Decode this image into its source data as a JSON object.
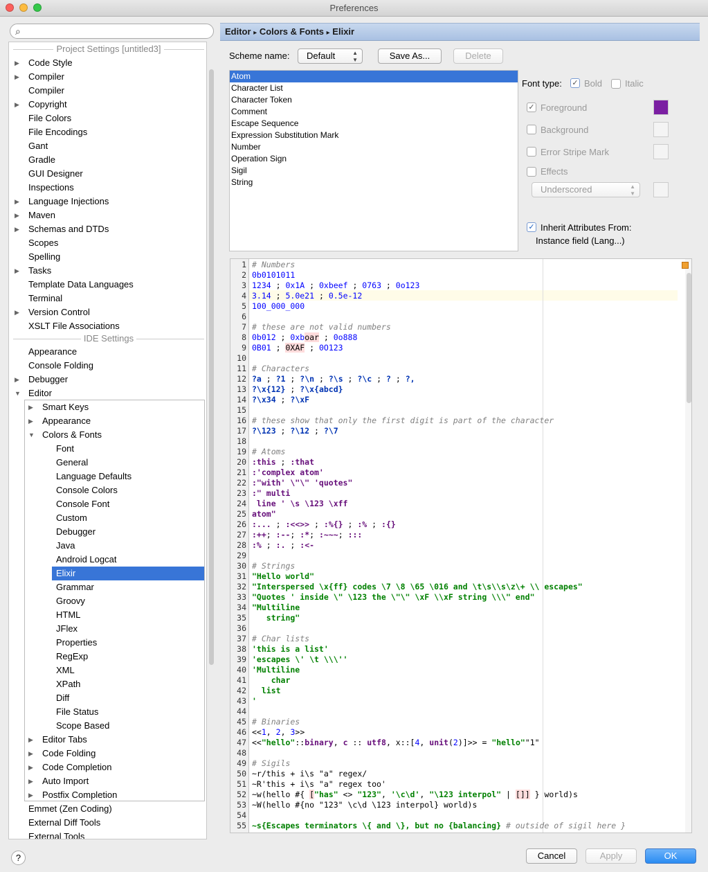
{
  "window": {
    "title": "Preferences"
  },
  "search": {
    "placeholder": ""
  },
  "sidebar": {
    "section_project": "Project Settings [untitled3]",
    "project_items": [
      {
        "label": "Code Style",
        "arrow": "▶"
      },
      {
        "label": "Compiler",
        "arrow": "▶"
      },
      {
        "label": "Compiler",
        "arrow": ""
      },
      {
        "label": "Copyright",
        "arrow": "▶"
      },
      {
        "label": "File Colors",
        "arrow": ""
      },
      {
        "label": "File Encodings",
        "arrow": ""
      },
      {
        "label": "Gant",
        "arrow": ""
      },
      {
        "label": "Gradle",
        "arrow": ""
      },
      {
        "label": "GUI Designer",
        "arrow": ""
      },
      {
        "label": "Inspections",
        "arrow": ""
      },
      {
        "label": "Language Injections",
        "arrow": "▶"
      },
      {
        "label": "Maven",
        "arrow": "▶"
      },
      {
        "label": "Schemas and DTDs",
        "arrow": "▶"
      },
      {
        "label": "Scopes",
        "arrow": ""
      },
      {
        "label": "Spelling",
        "arrow": ""
      },
      {
        "label": "Tasks",
        "arrow": "▶"
      },
      {
        "label": "Template Data Languages",
        "arrow": ""
      },
      {
        "label": "Terminal",
        "arrow": ""
      },
      {
        "label": "Version Control",
        "arrow": "▶"
      },
      {
        "label": "XSLT File Associations",
        "arrow": ""
      }
    ],
    "section_ide": "IDE Settings",
    "ide_items": [
      {
        "label": "Appearance",
        "arrow": ""
      },
      {
        "label": "Console Folding",
        "arrow": ""
      },
      {
        "label": "Debugger",
        "arrow": "▶"
      },
      {
        "label": "Editor",
        "arrow": "▼"
      }
    ],
    "editor_items": [
      {
        "label": "Smart Keys",
        "arrow": "▶"
      },
      {
        "label": "Appearance",
        "arrow": "▶"
      },
      {
        "label": "Colors & Fonts",
        "arrow": "▼"
      }
    ],
    "colors_fonts_items": [
      "Font",
      "General",
      "Language Defaults",
      "Console Colors",
      "Console Font",
      "Custom",
      "Debugger",
      "Java",
      "Android Logcat",
      "Elixir",
      "Grammar",
      "Groovy",
      "HTML",
      "JFlex",
      "Properties",
      "RegExp",
      "XML",
      "XPath",
      "Diff",
      "File Status",
      "Scope Based"
    ],
    "selected": "Elixir",
    "editor_items_after": [
      {
        "label": "Editor Tabs",
        "arrow": "▶"
      },
      {
        "label": "Code Folding",
        "arrow": "▶"
      },
      {
        "label": "Code Completion",
        "arrow": "▶"
      },
      {
        "label": "Auto Import",
        "arrow": "▶"
      },
      {
        "label": "Postfix Completion",
        "arrow": "▶"
      }
    ],
    "ide_items_after": [
      {
        "label": "Emmet (Zen Coding)",
        "arrow": ""
      },
      {
        "label": "External Diff Tools",
        "arrow": ""
      },
      {
        "label": "External Tools",
        "arrow": ""
      }
    ]
  },
  "breadcrumb": {
    "parts": [
      "Editor",
      "Colors & Fonts",
      "Elixir"
    ],
    "separator": "▸"
  },
  "scheme": {
    "label": "Scheme name:",
    "value": "Default",
    "save_as": "Save As...",
    "delete": "Delete"
  },
  "attributes": {
    "items": [
      "Atom",
      "Character List",
      "Character Token",
      "Comment",
      "Escape Sequence",
      "Expression Substitution Mark",
      "Number",
      "Operation Sign",
      "Sigil",
      "String"
    ],
    "selected": "Atom"
  },
  "options": {
    "font_type_label": "Font type:",
    "bold_label": "Bold",
    "bold_checked": true,
    "italic_label": "Italic",
    "italic_checked": false,
    "foreground_label": "Foreground",
    "foreground_checked": true,
    "foreground_color": "#7b1fa2",
    "background_label": "Background",
    "error_stripe_label": "Error Stripe Mark",
    "effects_label": "Effects",
    "effects_value": "Underscored",
    "inherit_label": "Inherit Attributes From:",
    "inherit_checked": true,
    "inherit_source": "Instance field (Lang...)"
  },
  "preview": {
    "lines": [
      [
        [
          "c",
          "# Numbers"
        ]
      ],
      [
        [
          "n",
          "0b0101011"
        ]
      ],
      [
        [
          "n",
          "1234"
        ],
        [
          "p",
          " ; "
        ],
        [
          "n",
          "0x1A"
        ],
        [
          "p",
          " ; "
        ],
        [
          "n",
          "0xbeef"
        ],
        [
          "p",
          " ; "
        ],
        [
          "n",
          "0763"
        ],
        [
          "p",
          " ; "
        ],
        [
          "n",
          "0o123"
        ]
      ],
      [
        [
          "n",
          "3.14"
        ],
        [
          "p",
          " ; "
        ],
        [
          "n",
          "5.0e21"
        ],
        [
          "p",
          " ; "
        ],
        [
          "n",
          "0.5e-12"
        ]
      ],
      [
        [
          "n",
          "100_000_000"
        ]
      ],
      [],
      [
        [
          "c",
          "# these are not valid numbers"
        ]
      ],
      [
        [
          "n",
          "0b012"
        ],
        [
          "p",
          " ; "
        ],
        [
          "n",
          "0xb"
        ],
        [
          "x",
          "oar"
        ],
        [
          "p",
          " ; "
        ],
        [
          "n",
          "0o888"
        ]
      ],
      [
        [
          "n",
          "0B01"
        ],
        [
          "p",
          " ; "
        ],
        [
          "x",
          "0XAF"
        ],
        [
          "p",
          " ; "
        ],
        [
          "n",
          "0O123"
        ]
      ],
      [],
      [
        [
          "c",
          "# Characters"
        ]
      ],
      [
        [
          "t",
          "?a"
        ],
        [
          "p",
          " ; "
        ],
        [
          "t",
          "?1"
        ],
        [
          "p",
          " ; "
        ],
        [
          "t",
          "?\\n"
        ],
        [
          "p",
          " ; "
        ],
        [
          "t",
          "?\\s"
        ],
        [
          "p",
          " ; "
        ],
        [
          "t",
          "?\\c"
        ],
        [
          "p",
          " ; "
        ],
        [
          "t",
          "? "
        ],
        [
          "p",
          "; "
        ],
        [
          "t",
          "?,"
        ]
      ],
      [
        [
          "t",
          "?\\x{12}"
        ],
        [
          "p",
          " ; "
        ],
        [
          "t",
          "?\\x{abcd}"
        ]
      ],
      [
        [
          "t",
          "?\\x34"
        ],
        [
          "p",
          " ; "
        ],
        [
          "t",
          "?\\xF"
        ]
      ],
      [],
      [
        [
          "c",
          "# these show that only the first digit is part of the character"
        ]
      ],
      [
        [
          "t",
          "?\\123"
        ],
        [
          "p",
          " ; "
        ],
        [
          "t",
          "?\\12"
        ],
        [
          "p",
          " ; "
        ],
        [
          "t",
          "?\\7"
        ]
      ],
      [],
      [
        [
          "c",
          "# Atoms"
        ]
      ],
      [
        [
          "a",
          ":this"
        ],
        [
          "p",
          " ; "
        ],
        [
          "a",
          ":that"
        ]
      ],
      [
        [
          "a",
          ":'complex atom'"
        ]
      ],
      [
        [
          "a",
          ":\"with' \\\"\\\" 'quotes\""
        ]
      ],
      [
        [
          "a",
          ":\" multi"
        ]
      ],
      [
        [
          "a",
          " line ' \\s \\123 \\xff"
        ]
      ],
      [
        [
          "a",
          "atom\""
        ]
      ],
      [
        [
          "a",
          ":..."
        ],
        [
          "p",
          " ; "
        ],
        [
          "a",
          ":<<>>"
        ],
        [
          "p",
          " ; "
        ],
        [
          "a",
          ":%{}"
        ],
        [
          "p",
          " ; "
        ],
        [
          "a",
          ":%"
        ],
        [
          "p",
          " ; "
        ],
        [
          "a",
          ":{}"
        ]
      ],
      [
        [
          "a",
          ":++"
        ],
        [
          "p",
          "; "
        ],
        [
          "a",
          ":--"
        ],
        [
          "p",
          "; "
        ],
        [
          "a",
          ":*"
        ],
        [
          "p",
          "; "
        ],
        [
          "a",
          ":~~~"
        ],
        [
          "p",
          "; "
        ],
        [
          "a",
          ":::"
        ]
      ],
      [
        [
          "a",
          ":%"
        ],
        [
          "p",
          " ; "
        ],
        [
          "a",
          ":."
        ],
        [
          "p",
          " ; "
        ],
        [
          "a",
          ":<-"
        ]
      ],
      [],
      [
        [
          "c",
          "# Strings"
        ]
      ],
      [
        [
          "s",
          "\"Hello world\""
        ]
      ],
      [
        [
          "s",
          "\"Interspersed \\x{ff} codes \\7 \\8 \\65 \\016 and \\t\\s\\\\s\\z\\+ \\\\ escapes\""
        ]
      ],
      [
        [
          "s",
          "\"Quotes ' inside \\\" \\123 the \\\"\\\" \\xF \\\\xF string \\\\\\\" end\""
        ]
      ],
      [
        [
          "s",
          "\"Multiline"
        ]
      ],
      [
        [
          "s",
          "   string\""
        ]
      ],
      [],
      [
        [
          "c",
          "# Char lists"
        ]
      ],
      [
        [
          "s",
          "'this is a list'"
        ]
      ],
      [
        [
          "s",
          "'escapes \\' \\t \\\\\\''"
        ]
      ],
      [
        [
          "s",
          "'Multiline"
        ]
      ],
      [
        [
          "s",
          "    char"
        ]
      ],
      [
        [
          "s",
          "  list"
        ]
      ],
      [
        [
          "s",
          "'"
        ]
      ],
      [],
      [
        [
          "c",
          "# Binaries"
        ]
      ],
      [
        [
          "p",
          "<<"
        ],
        [
          "n",
          "1"
        ],
        [
          "p",
          ", "
        ],
        [
          "n",
          "2"
        ],
        [
          "p",
          ", "
        ],
        [
          "n",
          "3"
        ],
        [
          "p",
          ">>"
        ]
      ],
      [
        [
          "p",
          "<<"
        ],
        [
          "s",
          "\"hello\""
        ],
        [
          "p",
          "::"
        ],
        [
          "a",
          "binary"
        ],
        [
          "p",
          ", "
        ],
        [
          "a",
          "c"
        ],
        [
          "p",
          " :: "
        ],
        [
          "a",
          "utf8"
        ],
        [
          "p",
          ", x::["
        ],
        [
          "n",
          "4"
        ],
        [
          "p",
          ", "
        ],
        [
          "a",
          "unit"
        ],
        [
          "p",
          "("
        ],
        [
          "n",
          "2"
        ],
        [
          "p",
          ")]>> = "
        ],
        [
          "s",
          "\"hello\""
        ],
        [
          "p",
          "\"1\""
        ]
      ],
      [],
      [
        [
          "c",
          "# Sigils"
        ]
      ],
      [
        [
          "p",
          "~r/this + i\\s \"a\" regex/"
        ]
      ],
      [
        [
          "p",
          "~R'this + i\\s \"a\" regex too'"
        ]
      ],
      [
        [
          "p",
          "~w(hello #{ "
        ],
        [
          "x",
          "["
        ],
        [
          "s",
          "\"has\""
        ],
        [
          "p",
          " <> "
        ],
        [
          "s",
          "\"123\""
        ],
        [
          "p",
          ", "
        ],
        [
          "s",
          "'\\c\\d'"
        ],
        [
          "p",
          ", "
        ],
        [
          "s",
          "\"\\123 interpol\""
        ],
        [
          "p",
          " | "
        ],
        [
          "x",
          "[]"
        ],
        [
          "x",
          "]"
        ],
        [
          "p",
          " } world)s"
        ]
      ],
      [
        [
          "p",
          "~W(hello #{no \"123\" \\c\\d \\123 interpol} world)s"
        ]
      ],
      [],
      [
        [
          "s",
          "~s{Escapes terminators \\{ and \\}, but no {balancing}"
        ],
        [
          "c",
          " # outside of sigil here }"
        ]
      ]
    ]
  },
  "footer": {
    "help": "?",
    "cancel": "Cancel",
    "apply": "Apply",
    "ok": "OK"
  }
}
